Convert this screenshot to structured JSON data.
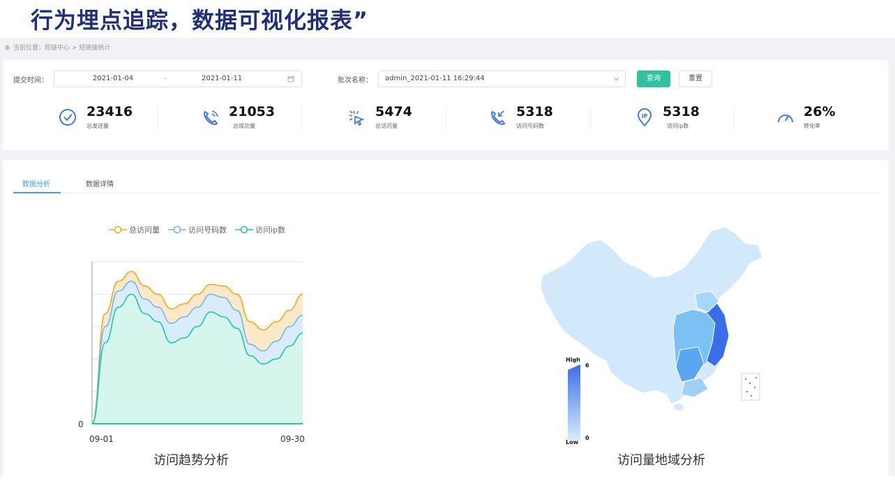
{
  "headline": "行为埋点追踪，数据可视化报表”",
  "breadcrumb": "当前位置：短链中心 > 短链接统计",
  "filters": {
    "time_label": "提交时间：",
    "start_date": "2021-01-04",
    "separator": "–",
    "end_date": "2021-01-11",
    "batch_label": "批次名称：",
    "batch_value": "admin_2021-01-11 16:29:44",
    "query_btn": "查询",
    "reset_btn": "重置"
  },
  "stats": [
    {
      "value": "23416",
      "label": "总发送量",
      "icon": "check-circle-icon"
    },
    {
      "value": "21053",
      "label": "总成功量",
      "icon": "phone-icon"
    },
    {
      "value": "5474",
      "label": "总访问量",
      "icon": "click-icon"
    },
    {
      "value": "5318",
      "label": "访问号码数",
      "icon": "phone-incoming-icon"
    },
    {
      "value": "5318",
      "label": "访问ip数",
      "icon": "ip-pin-icon"
    },
    {
      "value": "26%",
      "label": "转化率",
      "icon": "gauge-icon"
    }
  ],
  "tabs": [
    {
      "label": "数据分析",
      "active": true
    },
    {
      "label": "数据详情",
      "active": false
    }
  ],
  "colors": {
    "accent": "#409eff",
    "primary_btn": "#2ec2a0",
    "series_total": "#f5a623",
    "series_phone": "#6cb8f0",
    "series_ip": "#1ec99b",
    "map_high": "#3a6ee8",
    "map_low": "#d6ebfc"
  },
  "chart_data": {
    "type": "area",
    "title": "访问趋势分析",
    "x_start_label": "09-01",
    "x_end_label": "09-30",
    "y_zero_label": "0",
    "grid": true,
    "legend_placement": "top",
    "x": [
      0,
      5,
      10,
      15,
      20,
      25,
      30,
      35,
      40,
      45,
      50,
      55,
      60,
      65,
      70,
      75,
      80,
      85,
      90,
      95,
      100
    ],
    "series": [
      {
        "name": "总访问量",
        "values": [
          0,
          0.68,
          0.88,
          0.94,
          0.85,
          0.8,
          0.71,
          0.74,
          0.8,
          0.86,
          0.85,
          0.8,
          0.63,
          0.58,
          0.63,
          0.7,
          0.8
        ]
      },
      {
        "name": "访问号码数",
        "values": [
          0,
          0.6,
          0.82,
          0.88,
          0.77,
          0.72,
          0.62,
          0.66,
          0.72,
          0.8,
          0.78,
          0.7,
          0.49,
          0.45,
          0.51,
          0.6,
          0.67
        ]
      },
      {
        "name": "访问ip数",
        "values": [
          0,
          0.5,
          0.72,
          0.8,
          0.68,
          0.63,
          0.5,
          0.53,
          0.6,
          0.69,
          0.66,
          0.59,
          0.42,
          0.37,
          0.4,
          0.48,
          0.56
        ]
      }
    ]
  },
  "map": {
    "title": "访问量地域分析",
    "visual_map_high": "High",
    "visual_map_low": "Low",
    "visual_map_max": "6",
    "visual_map_min": "0"
  }
}
